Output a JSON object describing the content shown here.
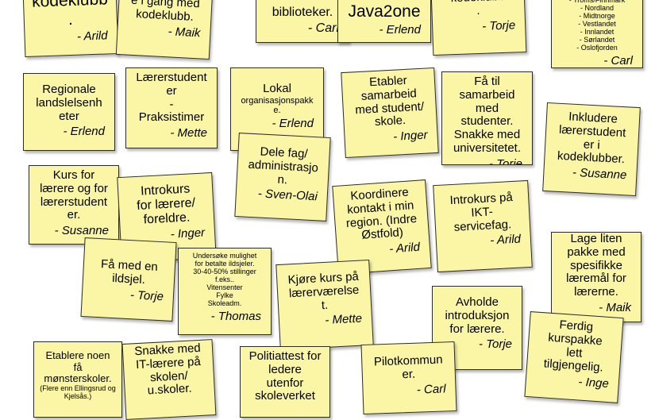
{
  "notes": [
    {
      "id": "n1",
      "text": "kodeklubb\n.",
      "author": "- Arild"
    },
    {
      "id": "n2",
      "text": "e i gang med\nkodeklubb.",
      "author": "- Maik"
    },
    {
      "id": "n3",
      "text": "biblioteker.",
      "author": "- Carl"
    },
    {
      "id": "n4",
      "text": "Java2one",
      "author": "- Erlend"
    },
    {
      "id": "n5",
      "text": "kodeklubb\n.",
      "author": "- Torje"
    },
    {
      "id": "n6",
      "text": "- Troms/Finnmark\n- Nordland\n- Midtnorge\n- Vestlandet\n- Innlandet\n- Sørlandet\n- Oslofjorden",
      "author": "- Carl"
    },
    {
      "id": "n7",
      "text": "Regionale\nlandslelsenh\neter",
      "author": "- Erlend"
    },
    {
      "id": "n8",
      "text": "Lærerstudent\ner\n-\nPraksistimer",
      "author": "- Mette"
    },
    {
      "id": "n9",
      "text": "Lokal",
      "sub": "organisasjonspakk\ne.",
      "author": "- Erlend"
    },
    {
      "id": "n10",
      "text": "Etabler\nsamarbeid\nmed student/\nskole.",
      "author": "- Inger"
    },
    {
      "id": "n11",
      "text": "Få til\nsamarbeid\nmed\nstudenter.\nSnakke med\nuniversitetet.",
      "author": "- Torje"
    },
    {
      "id": "n12",
      "text": "Inkludere\nlærerstudent\ner i\nkodeklubber.",
      "author": "- Susanne"
    },
    {
      "id": "n13",
      "text": "Dele fag/\nadministrasjo\nn.",
      "author": "- Sven-Olai"
    },
    {
      "id": "n14",
      "text": "Kurs for\nlærere og for\nlærerstudent\ner.",
      "author": "- Susanne"
    },
    {
      "id": "n15",
      "text": "Introkurs\nfor lærere/\nforeldre.",
      "author": "- Inger"
    },
    {
      "id": "n16",
      "text": "Koordinere\nkontakt i min\nregion. (Indre\nØstfold)",
      "author": "- Arild"
    },
    {
      "id": "n17",
      "text": "Introkurs på\nIKT-\nservicefag.",
      "author": "- Arild"
    },
    {
      "id": "n18",
      "text": "Lage liten\npakke med\nspesifikke\nlæremål for\nlærerne.",
      "author": "- Maik"
    },
    {
      "id": "n19",
      "text": "Få med en\nildsjel.",
      "author": "- Torje"
    },
    {
      "id": "n20",
      "text": "Undersøke mulighet\nfor betalte ildsjeler.\n30-40-50% stillinger\nf.eks..\nVitensenter\nFylke\nSkoleadm.",
      "author": "- Thomas"
    },
    {
      "id": "n21",
      "text": "Kjøre kurs på\nlærerværelse\nt.",
      "author": "- Mette"
    },
    {
      "id": "n22",
      "text": "Avholde\nintroduksjon\nfor lærere.",
      "author": "- Torje"
    },
    {
      "id": "n23",
      "text": "Ferdig\nkurspakke\nlett\ntilgjengelig.",
      "author": "- Inge"
    },
    {
      "id": "n24",
      "text": "Etablere noen\nfå\nmønsterskoler.",
      "paren": "(Flere enn Ellingsrud og\nKjelsås.)",
      "author": ""
    },
    {
      "id": "n25",
      "text": "Snakke med\nIT-lærere på\nskolen/\nu.skoler.",
      "author": ""
    },
    {
      "id": "n26",
      "text": "Politiattest for\nledere\nutenfor\nskoleverket",
      "author": ""
    },
    {
      "id": "n27",
      "text": "Pilotkommun\ner.",
      "author": "- Carl"
    }
  ]
}
